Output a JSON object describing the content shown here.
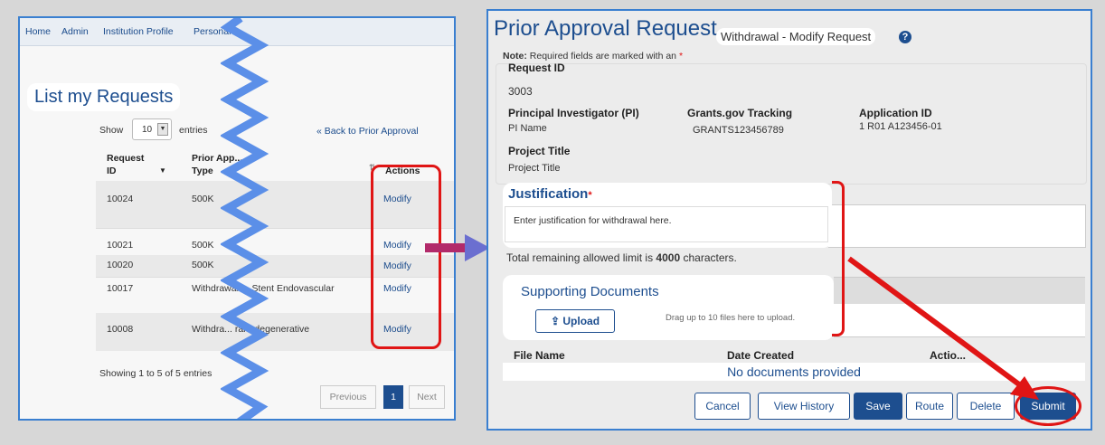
{
  "left": {
    "nav": [
      "Home",
      "Admin",
      "Institution Profile",
      "Personal"
    ],
    "title": "List my Requests",
    "show_label": "Show",
    "entries_value": "10",
    "entries_label": "entries",
    "back_link": "« Back to Prior Approval",
    "columns": {
      "request_id": "Request ID",
      "prior_approval_type": "Prior App... Type",
      "actions": "Actions"
    },
    "rows": [
      {
        "id": "10024",
        "type": "500K",
        "action": "Modify"
      },
      {
        "id": "10021",
        "type": "500K",
        "action": "Modify"
      },
      {
        "id": "10020",
        "type": "500K",
        "action": "Modify"
      },
      {
        "id": "10017",
        "type": "Withdrawal ... Stent Endovascular",
        "action": "Modify"
      },
      {
        "id": "10008",
        "type": "Withdra... rare degenerative",
        "action": "Modify"
      }
    ],
    "showing": "Showing 1 to 5 of 5 entries",
    "pagination": {
      "previous": "Previous",
      "page": "1",
      "next": "Next"
    }
  },
  "right": {
    "title": "Prior Approval Request",
    "subtitle": "Withdrawal - Modify Request",
    "note_bold": "Note:",
    "note_text": "Required fields are marked with an",
    "request_id_label": "Request ID",
    "request_id": "3003",
    "pi_label": "Principal Investigator (PI)",
    "pi_value": "PI Name",
    "grants_label": "Grants.gov Tracking",
    "grants_value": "GRANTS123456789",
    "app_id_label": "Application ID",
    "app_id_value": "1 R01 A123456-01",
    "project_title_label": "Project Title",
    "project_title_value": "Project Title",
    "justification_label": "Justification",
    "justification_value": "Enter justification for withdrawal here.",
    "limit_prefix": "Total remaining allowed limit is",
    "limit_value": "4000",
    "limit_suffix": "characters.",
    "supporting_docs": "Supporting Documents",
    "upload_label": "Upload",
    "drag_text": "Drag up to 10 files here to upload.",
    "file_columns": {
      "file_name": "File Name",
      "date_created": "Date Created",
      "actions": "Actio..."
    },
    "no_docs": "No documents provided",
    "buttons": {
      "cancel": "Cancel",
      "view_history": "View History",
      "save": "Save",
      "route": "Route",
      "delete": "Delete",
      "submit": "Submit"
    }
  },
  "colors": {
    "accent": "#1d4e8f",
    "highlight": "#e01515",
    "frame": "#3a7fd0"
  }
}
